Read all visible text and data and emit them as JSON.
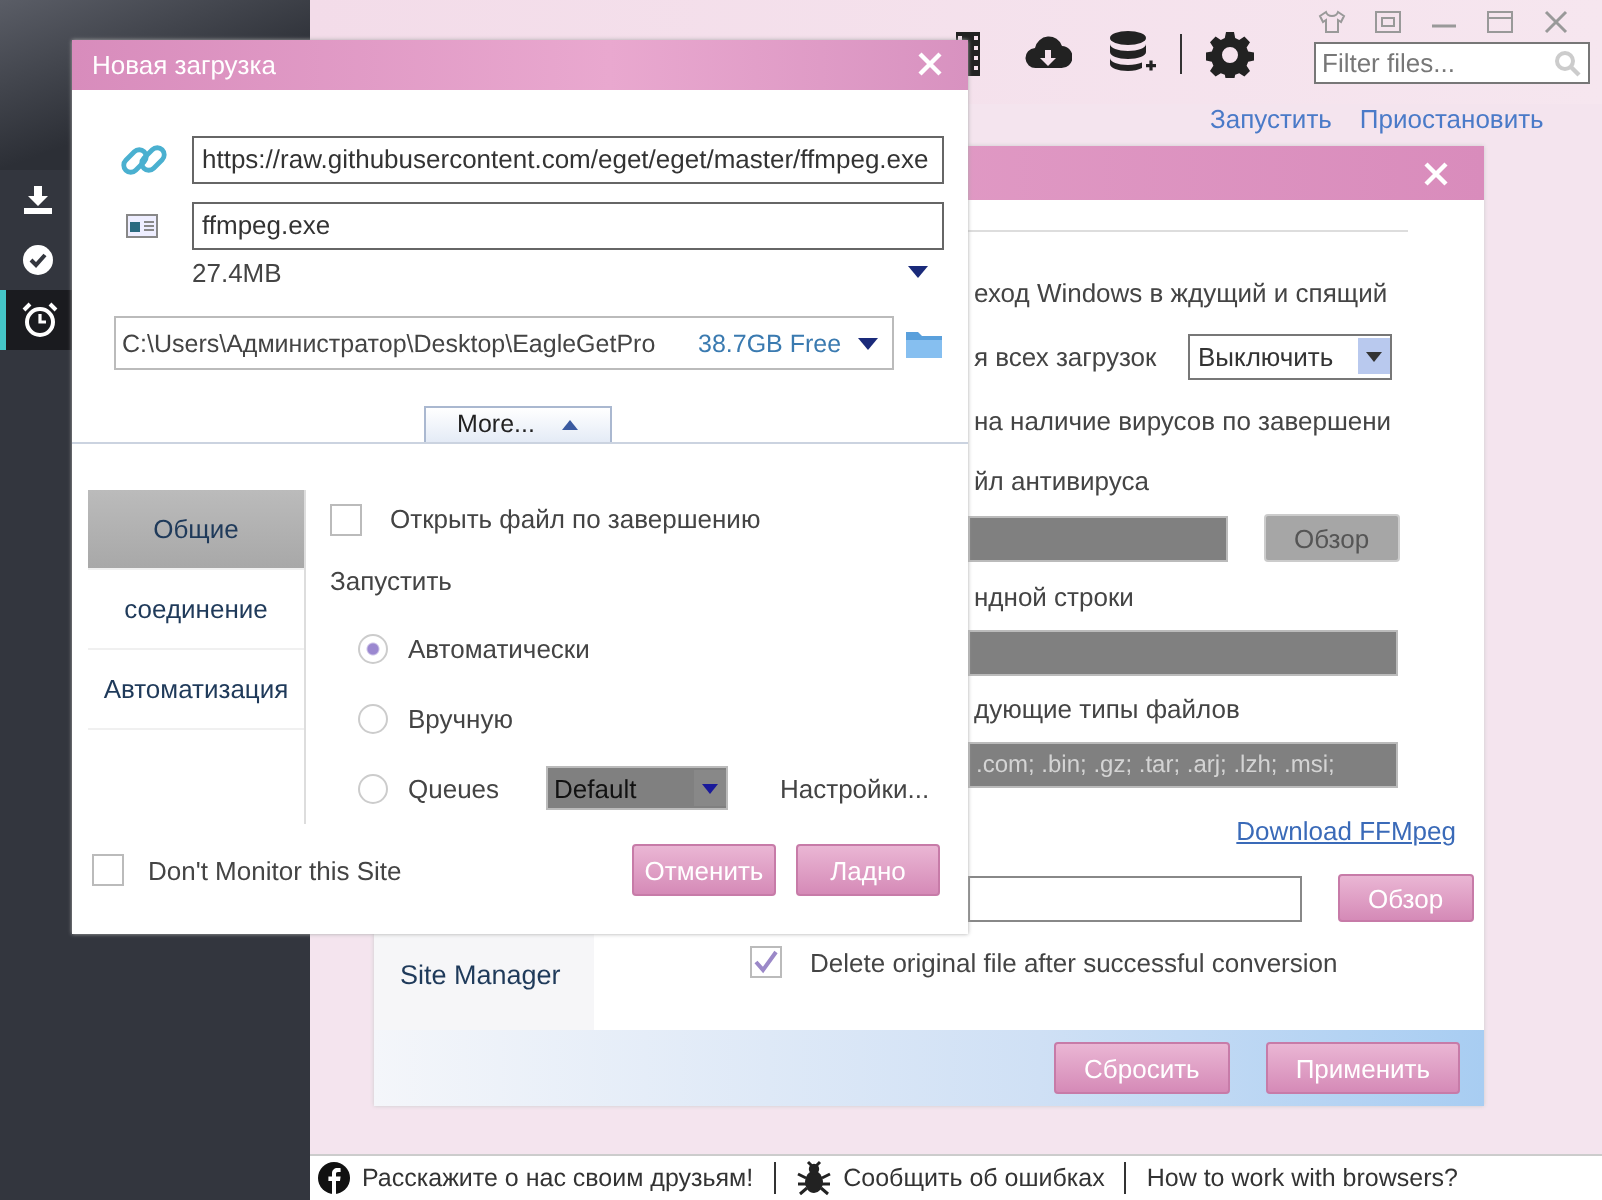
{
  "sidebar": {
    "items": [
      {
        "kind": "download",
        "selected": false
      },
      {
        "kind": "done",
        "selected": false
      },
      {
        "kind": "alarm",
        "selected": true
      }
    ]
  },
  "toolbar": {
    "search": {
      "placeholder": "Filter files..."
    }
  },
  "actions": [
    "Запустить",
    "Приостановить"
  ],
  "settings_dialog": {
    "nav": [
      {
        "label": "Site Manager",
        "selected": false
      }
    ],
    "rows": [
      {
        "kind": "text",
        "text": "еход Windows в ждущий и спящий"
      },
      {
        "kind": "select",
        "text": "я всех загрузок",
        "value": "Выключить"
      },
      {
        "kind": "text",
        "text": "на наличие вирусов по завершени"
      },
      {
        "kind": "text",
        "text": "йл антивируса"
      },
      {
        "kind": "field_button",
        "disabled": true,
        "button": "Обзор"
      },
      {
        "kind": "text",
        "text": "ндной строки"
      },
      {
        "kind": "field",
        "disabled": true
      },
      {
        "kind": "text",
        "text": "дующие типы файлов"
      },
      {
        "kind": "field",
        "disabled": true,
        "value": ".com; .bin; .gz; .tar; .arj; .lzh; .msi;"
      },
      {
        "kind": "link",
        "text": "Download FFMpeg"
      },
      {
        "kind": "field_button",
        "disabled": false,
        "button": "Обзор"
      },
      {
        "kind": "check",
        "checked": true,
        "text": "Delete original file after successful conversion"
      }
    ],
    "buttons": [
      "Сбросить",
      "Применить"
    ]
  },
  "download_dialog": {
    "title": "Новая загрузка",
    "url": "https://raw.githubusercontent.com/eget/eget/master/ffmpeg.exe",
    "file_name": "ffmpeg.exe",
    "size": "27.4MB",
    "path": "C:\\Users\\Администратор\\Desktop\\EagleGetPro",
    "free_space": "38.7GB Free",
    "more_button": "More...",
    "tabs": [
      {
        "label": "Общие",
        "selected": true
      },
      {
        "label": "соединение",
        "selected": false
      },
      {
        "label": "Автоматизация",
        "selected": false
      }
    ],
    "open_when_done": {
      "label": "Открыть файл по завершению",
      "checked": false
    },
    "start_label": "Запустить",
    "start_options": [
      {
        "label": "Автоматически",
        "selected": true
      },
      {
        "label": "Вручную",
        "selected": false
      },
      {
        "label": "Queues",
        "selected": false
      }
    ],
    "queue": {
      "value": "Default"
    },
    "settings_link": "Настройки...",
    "dont_monitor": {
      "label": "Don't Monitor this Site",
      "checked": false
    },
    "buttons": [
      "Отменить",
      "Ладно"
    ]
  },
  "status_bar": {
    "items": [
      {
        "kind": "facebook",
        "label": "Расскажите о нас своим друзьям!"
      },
      {
        "kind": "bug",
        "label": "Сообщить об ошибках"
      },
      {
        "kind": "plain",
        "label": "How to work with browsers?"
      }
    ]
  }
}
